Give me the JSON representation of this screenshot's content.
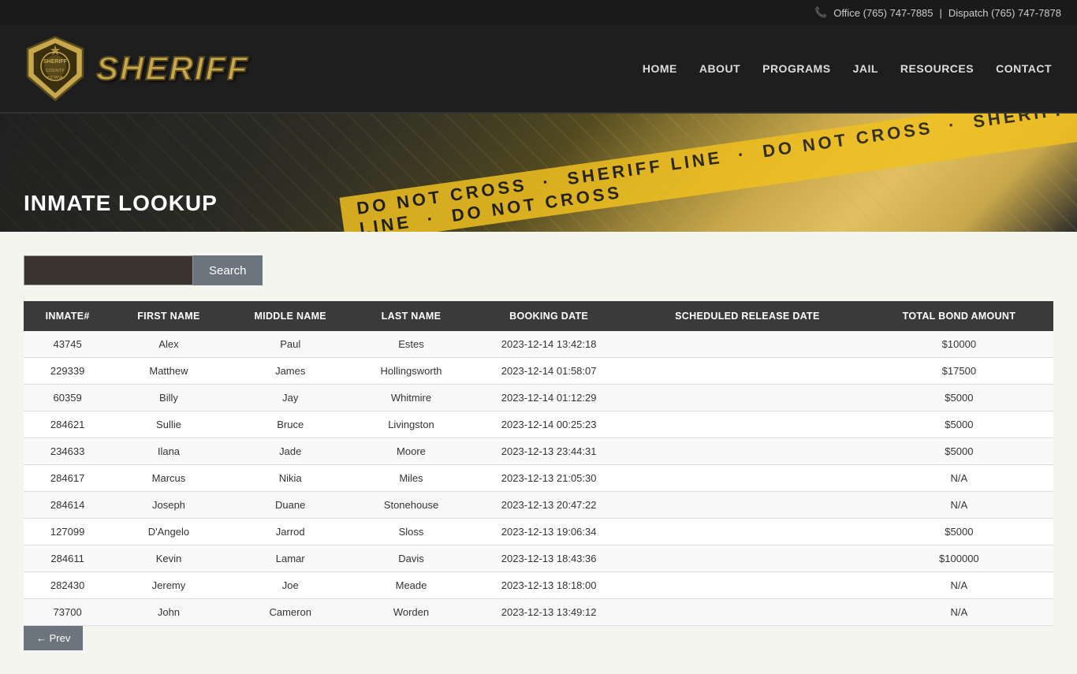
{
  "topbar": {
    "phone_icon": "📞",
    "office_label": "Office (765) 747-7885",
    "separator": "|",
    "dispatch_label": "Dispatch (765) 747-7878"
  },
  "nav": {
    "items": [
      {
        "label": "HOME",
        "id": "home"
      },
      {
        "label": "ABOUT",
        "id": "about"
      },
      {
        "label": "PROGRAMS",
        "id": "programs"
      },
      {
        "label": "JAIL",
        "id": "jail"
      },
      {
        "label": "RESOURCES",
        "id": "resources"
      },
      {
        "label": "CONTACT",
        "id": "contact"
      }
    ]
  },
  "hero": {
    "tape_text": "DO NOT CROSS · SHERIFF LINE · DO NOT CROSS",
    "page_title": "INMATE LOOKUP"
  },
  "search": {
    "input_placeholder": "",
    "button_label": "Search"
  },
  "table": {
    "columns": [
      "INMATE#",
      "FIRST NAME",
      "MIDDLE NAME",
      "LAST NAME",
      "BOOKING DATE",
      "SCHEDULED RELEASE DATE",
      "TOTAL BOND AMOUNT"
    ],
    "rows": [
      {
        "inmate": "43745",
        "first": "Alex",
        "middle": "Paul",
        "last": "Estes",
        "booking": "2023-12-14 13:42:18",
        "release": "",
        "bond": "$10000"
      },
      {
        "inmate": "229339",
        "first": "Matthew",
        "middle": "James",
        "last": "Hollingsworth",
        "booking": "2023-12-14 01:58:07",
        "release": "",
        "bond": "$17500"
      },
      {
        "inmate": "60359",
        "first": "Billy",
        "middle": "Jay",
        "last": "Whitmire",
        "booking": "2023-12-14 01:12:29",
        "release": "",
        "bond": "$5000"
      },
      {
        "inmate": "284621",
        "first": "Sullie",
        "middle": "Bruce",
        "last": "Livingston",
        "booking": "2023-12-14 00:25:23",
        "release": "",
        "bond": "$5000"
      },
      {
        "inmate": "234633",
        "first": "Ilana",
        "middle": "Jade",
        "last": "Moore",
        "booking": "2023-12-13 23:44:31",
        "release": "",
        "bond": "$5000"
      },
      {
        "inmate": "284617",
        "first": "Marcus",
        "middle": "Nikia",
        "last": "Miles",
        "booking": "2023-12-13 21:05:30",
        "release": "",
        "bond": "N/A"
      },
      {
        "inmate": "284614",
        "first": "Joseph",
        "middle": "Duane",
        "last": "Stonehouse",
        "booking": "2023-12-13 20:47:22",
        "release": "",
        "bond": "N/A"
      },
      {
        "inmate": "127099",
        "first": "D'Angelo",
        "middle": "Jarrod",
        "last": "Sloss",
        "booking": "2023-12-13 19:06:34",
        "release": "",
        "bond": "$5000"
      },
      {
        "inmate": "284611",
        "first": "Kevin",
        "middle": "Lamar",
        "last": "Davis",
        "booking": "2023-12-13 18:43:36",
        "release": "",
        "bond": "$100000"
      },
      {
        "inmate": "282430",
        "first": "Jeremy",
        "middle": "Joe",
        "last": "Meade",
        "booking": "2023-12-13 18:18:00",
        "release": "",
        "bond": "N/A"
      },
      {
        "inmate": "73700",
        "first": "John",
        "middle": "Cameron",
        "last": "Worden",
        "booking": "2023-12-13 13:49:12",
        "release": "",
        "bond": "N/A"
      }
    ]
  },
  "pagination": {
    "prev_label": "← Prev"
  }
}
